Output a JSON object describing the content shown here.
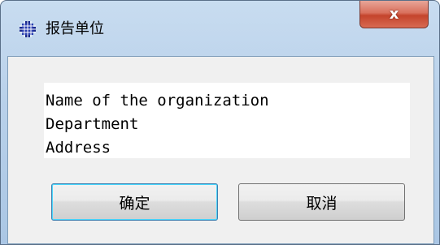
{
  "window": {
    "title": "报告单位",
    "close_glyph": "x"
  },
  "content": {
    "lines": [
      "Name of the organization",
      "Department",
      "Address"
    ]
  },
  "buttons": {
    "ok_label": "确定",
    "cancel_label": "取消"
  },
  "colors": {
    "title_bar": "#b9d1ea",
    "close_button": "#c4442c",
    "dialog_background": "#f0f0f0"
  }
}
